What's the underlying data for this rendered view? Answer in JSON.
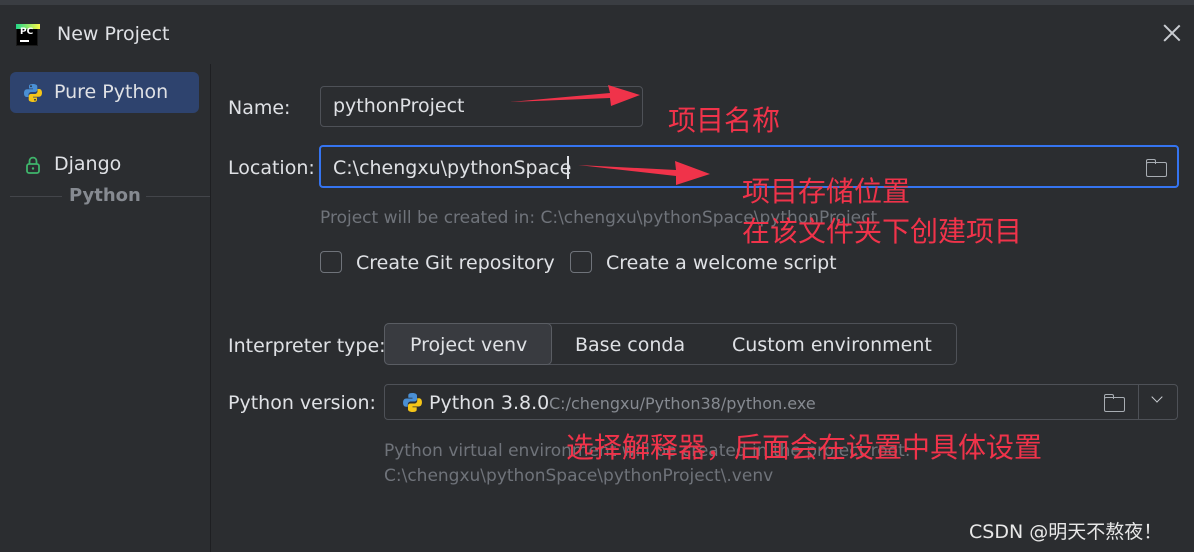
{
  "window": {
    "title": "New Project"
  },
  "sidebar": {
    "items": [
      {
        "label": "Pure Python",
        "icon": "python-icon",
        "selected": true
      },
      {
        "label": "Django",
        "icon": "lock-icon",
        "selected": false
      }
    ],
    "section_header": "Python"
  },
  "form": {
    "name_label": "Name:",
    "name_value": "pythonProject",
    "location_label": "Location:",
    "location_value": "C:\\chengxu\\pythonSpace",
    "location_hint": "Project will be created in: C:\\chengxu\\pythonSpace\\pythonProject",
    "create_git_label": "Create Git repository",
    "create_git_checked": false,
    "welcome_script_label": "Create a welcome script",
    "welcome_script_checked": false,
    "interpreter_label": "Interpreter type:",
    "interpreter_options": [
      "Project venv",
      "Base conda",
      "Custom environment"
    ],
    "interpreter_selected": "Project venv",
    "python_version_label": "Python version:",
    "python_version_value": "Python 3.8.0",
    "python_version_path": "C:/chengxu/Python38/python.exe",
    "venv_hint_line1": "Python virtual environment will be created in the project root:",
    "venv_hint_line2": "C:\\chengxu\\pythonSpace\\pythonProject\\.venv"
  },
  "annotations": {
    "project_name": "项目名称",
    "project_location_1": "项目存储位置",
    "project_location_2": "在该文件夹下创建项目",
    "interpreter": "选择解释器，后面会在设置中具体设置",
    "color": "#f0334a"
  },
  "watermark": "CSDN @明天不熬夜！"
}
